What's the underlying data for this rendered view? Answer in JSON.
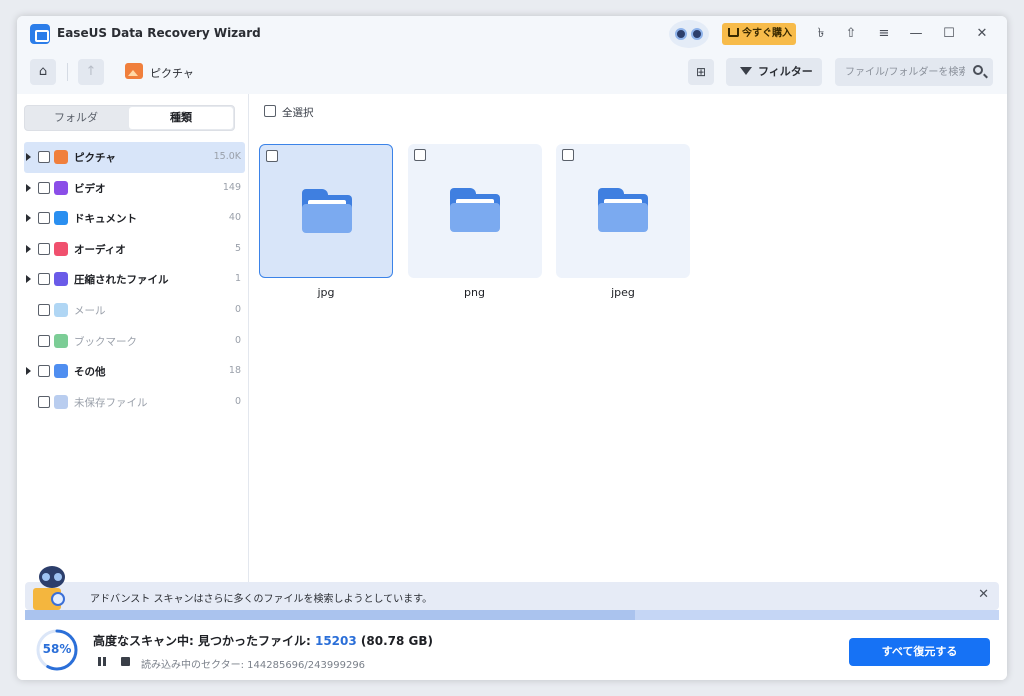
{
  "app": {
    "title": "EaseUS Data Recovery Wizard"
  },
  "titlebar": {
    "buy_label": "今すぐ購入"
  },
  "toolbar": {
    "breadcrumb": "ピクチャ",
    "filter_label": "フィルター",
    "search_placeholder": "ファイル/フォルダーを検索"
  },
  "sidebar": {
    "tabs": [
      {
        "label": "フォルダ",
        "active": false
      },
      {
        "label": "種類",
        "active": true
      }
    ],
    "categories": [
      {
        "label": "ピクチャ",
        "count": "15.0K",
        "expandable": true,
        "selected": true,
        "enabled": true,
        "icon": "picture-icon",
        "color": "#f07f3c"
      },
      {
        "label": "ビデオ",
        "count": "149",
        "expandable": true,
        "selected": false,
        "enabled": true,
        "icon": "video-icon",
        "color": "#8b4ee8"
      },
      {
        "label": "ドキュメント",
        "count": "40",
        "expandable": true,
        "selected": false,
        "enabled": true,
        "icon": "document-icon",
        "color": "#2a8ff0"
      },
      {
        "label": "オーディオ",
        "count": "5",
        "expandable": true,
        "selected": false,
        "enabled": true,
        "icon": "audio-icon",
        "color": "#f0506e"
      },
      {
        "label": "圧縮されたファイル",
        "count": "1",
        "expandable": true,
        "selected": false,
        "enabled": true,
        "icon": "archive-icon",
        "color": "#6a5be8"
      },
      {
        "label": "メール",
        "count": "0",
        "expandable": false,
        "selected": false,
        "enabled": false,
        "icon": "mail-icon",
        "color": "#8fc4f0"
      },
      {
        "label": "ブックマーク",
        "count": "0",
        "expandable": false,
        "selected": false,
        "enabled": false,
        "icon": "bookmark-icon",
        "color": "#45b86a"
      },
      {
        "label": "その他",
        "count": "18",
        "expandable": true,
        "selected": false,
        "enabled": true,
        "icon": "other-icon",
        "color": "#4f8ef0"
      },
      {
        "label": "未保存ファイル",
        "count": "0",
        "expandable": false,
        "selected": false,
        "enabled": false,
        "icon": "unsaved-file-icon",
        "color": "#9bb8e8"
      }
    ]
  },
  "main": {
    "select_all_label": "全選択",
    "folders": [
      {
        "name": "jpg",
        "selected": true
      },
      {
        "name": "png",
        "selected": false
      },
      {
        "name": "jpeg",
        "selected": false
      }
    ]
  },
  "notice": {
    "text": "アドバンスト スキャンはさらに多くのファイルを検索しようとしています。"
  },
  "status": {
    "progress_percent": 58,
    "progress_label": "58%",
    "scan_label": "高度なスキャン中: 見つかったファイル: ",
    "file_count": "15203",
    "size": " (80.78 GB)",
    "sector_text": "読み込み中のセクター: 144285696/243999296"
  },
  "actions": {
    "recover_all_label": "すべて復元する"
  },
  "colors": {
    "accent": "#1672f5",
    "selected_bg": "#d8e5f9"
  }
}
